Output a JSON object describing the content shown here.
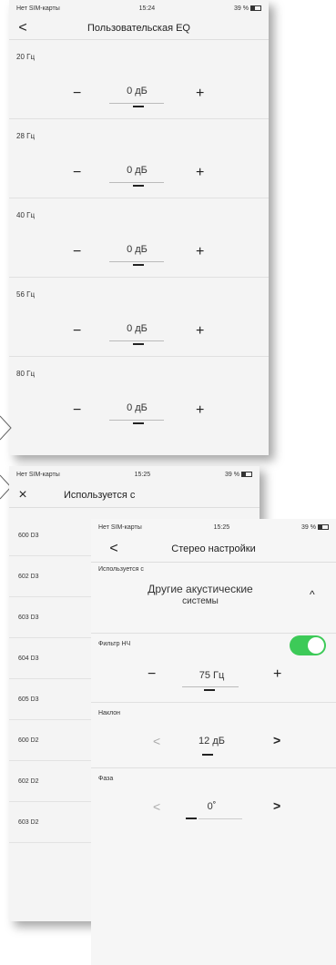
{
  "eq_screen": {
    "status": {
      "carrier": "Нет SIM-карты",
      "time": "15:24",
      "battery": "39 %"
    },
    "title": "Пользовательская EQ",
    "back": "<",
    "rows": [
      {
        "label": "20 Гц",
        "value": "0 дБ"
      },
      {
        "label": "28 Гц",
        "value": "0 дБ"
      },
      {
        "label": "40 Гц",
        "value": "0 дБ"
      },
      {
        "label": "56 Гц",
        "value": "0 дБ"
      },
      {
        "label": "80 Гц",
        "value": "0 дБ"
      }
    ],
    "minus": "−",
    "plus": "+"
  },
  "used_with_screen": {
    "status": {
      "carrier": "Нет SIM-карты",
      "time": "15:25",
      "battery": "39 %"
    },
    "title": "Используется с",
    "close": "×",
    "items": [
      "600 D3",
      "602 D3",
      "603 D3",
      "604 D3",
      "605 D3",
      "600 D2",
      "602 D2",
      "603 D2"
    ]
  },
  "stereo_screen": {
    "status": {
      "carrier": "Нет SIM-карты",
      "time": "15:25",
      "battery": "39 %"
    },
    "title": "Стерео настройки",
    "back": "<",
    "used_with_label": "Используется с",
    "used_with_value_line1": "Другие акустические",
    "used_with_value_line2": "системы",
    "chevron_up": "^",
    "lowpass_label": "Фильтр НЧ",
    "lowpass_value": "75 Гц",
    "slope_label": "Наклон",
    "slope_value": "12 дБ",
    "phase_label": "Фаза",
    "phase_value": "0˚",
    "minus": "−",
    "plus": "+",
    "left": "<",
    "right": ">"
  },
  "colors": {
    "toggle_on": "#3dca58"
  }
}
